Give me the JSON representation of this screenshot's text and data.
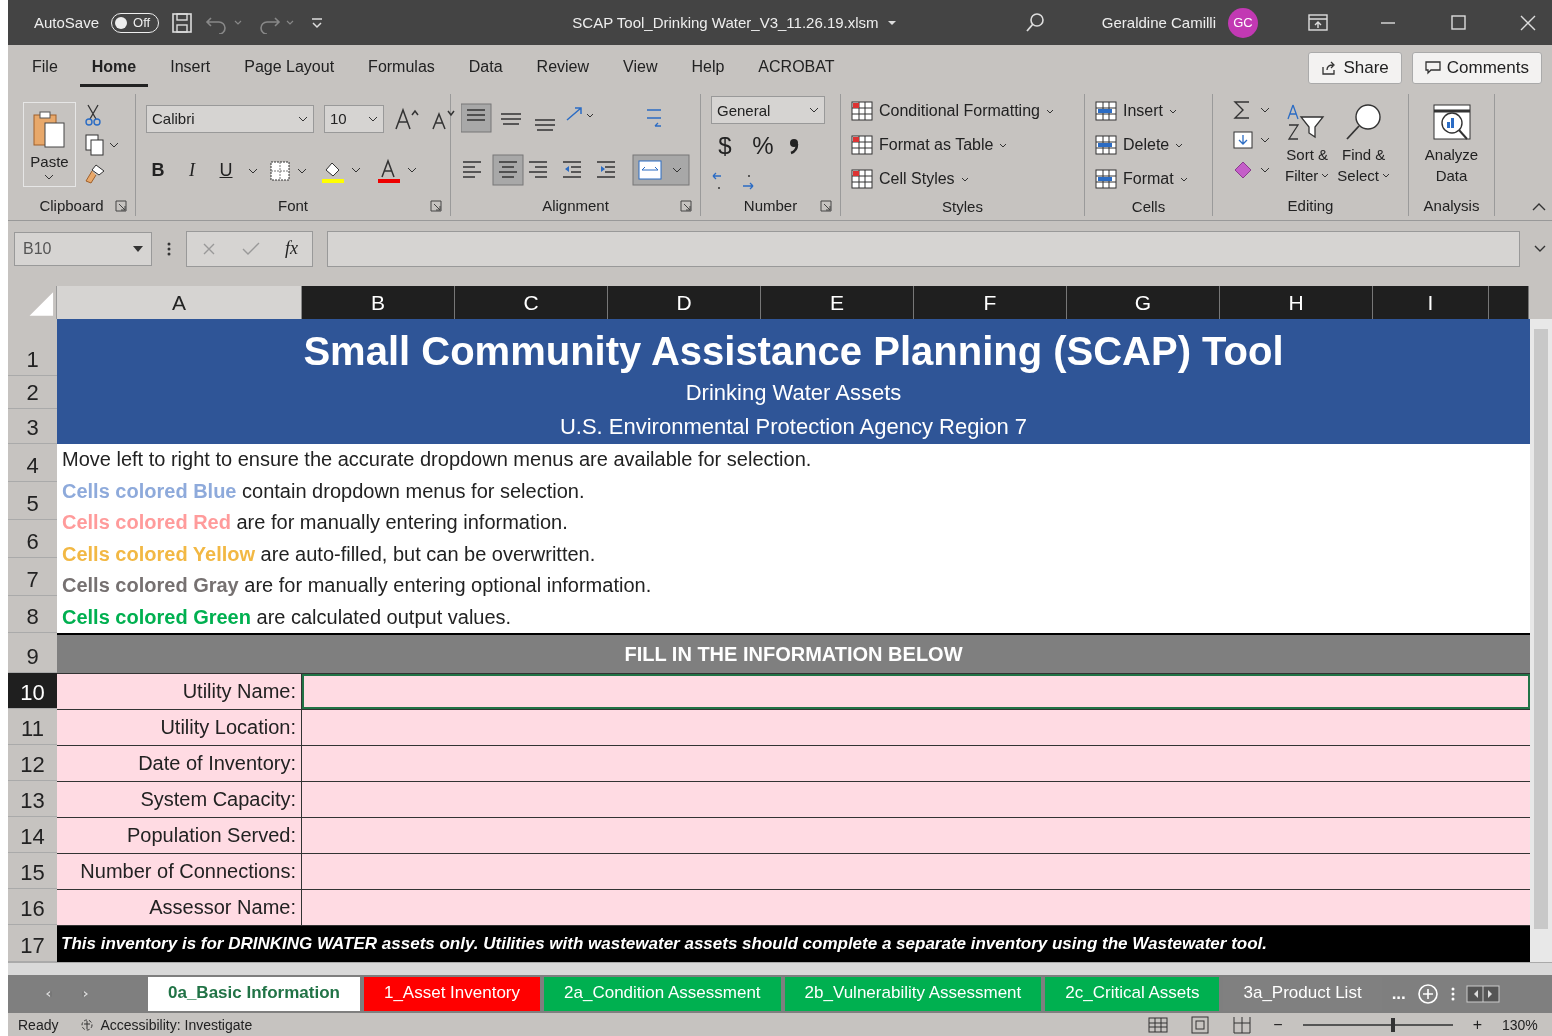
{
  "title_bar": {
    "autosave_label": "AutoSave",
    "autosave": {
      "label": "Off",
      "on": false
    },
    "file_name": "SCAP Tool_Drinking Water_V3_11.26.19.xlsm",
    "user_name": "Geraldine Camilli",
    "user_initials": "GC"
  },
  "ribbon_tabs": [
    {
      "label": "File",
      "selected": false
    },
    {
      "label": "Home",
      "selected": true
    },
    {
      "label": "Insert",
      "selected": false
    },
    {
      "label": "Page Layout",
      "selected": false
    },
    {
      "label": "Formulas",
      "selected": false
    },
    {
      "label": "Data",
      "selected": false
    },
    {
      "label": "Review",
      "selected": false
    },
    {
      "label": "View",
      "selected": false
    },
    {
      "label": "Help",
      "selected": false
    },
    {
      "label": "ACROBAT",
      "selected": false
    }
  ],
  "share_button": "Share",
  "comments_button": "Comments",
  "ribbon": {
    "clipboard": {
      "paste": "Paste",
      "label": "Clipboard"
    },
    "font": {
      "name": "Calibri",
      "size": "10",
      "buttons": [
        "B",
        "I",
        "U"
      ],
      "label": "Font"
    },
    "alignment": {
      "label": "Alignment"
    },
    "number": {
      "format": "General",
      "symbols": [
        "$",
        "%"
      ],
      "label": "Number"
    },
    "styles": {
      "items": [
        "Conditional Formatting",
        "Format as Table",
        "Cell Styles"
      ],
      "label": "Styles"
    },
    "cells": {
      "items": [
        "Insert",
        "Delete",
        "Format"
      ],
      "label": "Cells"
    },
    "editing": {
      "items": [
        {
          "line1": "Sort &",
          "line2": "Filter"
        },
        {
          "line1": "Find &",
          "line2": "Select"
        }
      ],
      "label": "Editing"
    },
    "analysis": {
      "line1": "Analyze",
      "line2": "Data",
      "label": "Analysis"
    }
  },
  "formula_bar": {
    "name_box": "B10",
    "function_label": "fx"
  },
  "columns": [
    {
      "label": "A",
      "selected": false
    },
    {
      "label": "B",
      "selected": true
    },
    {
      "label": "C",
      "selected": true
    },
    {
      "label": "D",
      "selected": true
    },
    {
      "label": "E",
      "selected": true
    },
    {
      "label": "F",
      "selected": true
    },
    {
      "label": "G",
      "selected": true
    },
    {
      "label": "H",
      "selected": true
    },
    {
      "label": "I",
      "selected": true
    }
  ],
  "row_headers": [
    {
      "label": "1",
      "selected": false
    },
    {
      "label": "2",
      "selected": false
    },
    {
      "label": "3",
      "selected": false
    },
    {
      "label": "4",
      "selected": false
    },
    {
      "label": "5",
      "selected": false
    },
    {
      "label": "6",
      "selected": false
    },
    {
      "label": "7",
      "selected": false
    },
    {
      "label": "8",
      "selected": false
    },
    {
      "label": "9",
      "selected": false
    },
    {
      "label": "10",
      "selected": true
    },
    {
      "label": "11",
      "selected": false
    },
    {
      "label": "12",
      "selected": false
    },
    {
      "label": "13",
      "selected": false
    },
    {
      "label": "14",
      "selected": false
    },
    {
      "label": "15",
      "selected": false
    },
    {
      "label": "16",
      "selected": false
    },
    {
      "label": "17",
      "selected": false
    }
  ],
  "sheet": {
    "title": "Small Community Assistance Planning (SCAP) Tool",
    "subtitle": "Drinking Water Assets",
    "agency": "U.S. Environmental Protection Agency Region 7",
    "instructions": [
      {
        "text": "Move left to right to ensure the accurate dropdown menus are available for selection."
      },
      {
        "highlight": "Cells colored Blue",
        "color": "#8eaadb",
        "text": "contain dropdown menus for selection."
      },
      {
        "highlight": "Cells colored Red",
        "color": "#ff9b9b",
        "text": "are for manually entering information."
      },
      {
        "highlight": "Cells colored Yellow",
        "color": "#f2b844",
        "text": " are auto-filled, but can be overwritten."
      },
      {
        "highlight": "Cells colored Gray",
        "color": "#767171",
        "text": " are for manually entering optional information."
      },
      {
        "highlight": "Cells colored Green",
        "color": "#00b050",
        "text": "are calculated output values."
      }
    ],
    "section_header": "FILL IN THE INFORMATION BELOW",
    "fields": [
      {
        "label": "Utility Name:",
        "selected": true
      },
      {
        "label": "Utility Location:",
        "selected": false
      },
      {
        "label": "Date of Inventory:",
        "selected": false
      },
      {
        "label": "System Capacity:",
        "selected": false
      },
      {
        "label": "Population Served:",
        "selected": false
      },
      {
        "label": "Number of Connections:",
        "selected": false
      },
      {
        "label": "Assessor Name:",
        "selected": false
      }
    ],
    "footer_note": "This inventory is for DRINKING WATER assets only. Utilities with wastewater assets should complete a separate inventory using the Wastewater tool."
  },
  "sheet_tabs": [
    {
      "label": "0a_Basic Information",
      "color": "#ffffff",
      "selected": true
    },
    {
      "label": "1_Asset Inventory",
      "color": "#ff0000",
      "selected": false
    },
    {
      "label": "2a_Condition Assessment",
      "color": "#00b050",
      "selected": false
    },
    {
      "label": "2b_Vulnerability Assessment",
      "color": "#00b050",
      "selected": false
    },
    {
      "label": "2c_Critical Assets",
      "color": "#00b050",
      "selected": false
    },
    {
      "label": "3a_Product List",
      "color": "#808080",
      "selected": false
    }
  ],
  "more_tabs": "...",
  "status_bar": {
    "status": "Ready",
    "accessibility": "Accessibility: Investigate",
    "zoom_out": "−",
    "zoom_in": "+",
    "zoom": "130%",
    "level": 0.6
  }
}
